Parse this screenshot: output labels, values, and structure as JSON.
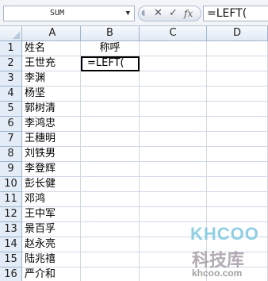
{
  "formula_bar": {
    "name_box": "SUM",
    "name_box_arrow": "▼",
    "grip": "◖",
    "cancel": "✕",
    "enter": "✓",
    "fx": "fx",
    "formula": "=LEFT("
  },
  "columns": [
    "A",
    "B",
    "C",
    "D"
  ],
  "rows": [
    {
      "n": "1",
      "a": "姓名",
      "b": "称呼"
    },
    {
      "n": "2",
      "a": "王世充",
      "b": "=LEFT("
    },
    {
      "n": "3",
      "a": "李渊",
      "b": ""
    },
    {
      "n": "4",
      "a": "杨坚",
      "b": ""
    },
    {
      "n": "5",
      "a": "郭树清",
      "b": ""
    },
    {
      "n": "6",
      "a": "李鸿忠",
      "b": ""
    },
    {
      "n": "7",
      "a": "王穗明",
      "b": ""
    },
    {
      "n": "8",
      "a": "刘铁男",
      "b": ""
    },
    {
      "n": "9",
      "a": "李登辉",
      "b": ""
    },
    {
      "n": "10",
      "a": "彭长健",
      "b": ""
    },
    {
      "n": "11",
      "a": "邓鸿",
      "b": ""
    },
    {
      "n": "12",
      "a": "王中军",
      "b": ""
    },
    {
      "n": "13",
      "a": "景百孚",
      "b": ""
    },
    {
      "n": "14",
      "a": "赵永亮",
      "b": ""
    },
    {
      "n": "15",
      "a": "陆兆禧",
      "b": ""
    },
    {
      "n": "16",
      "a": "严介和",
      "b": ""
    }
  ],
  "watermark": {
    "logo": "KHCOO",
    "cn": "科技库",
    "domain": "khcoo.com"
  }
}
